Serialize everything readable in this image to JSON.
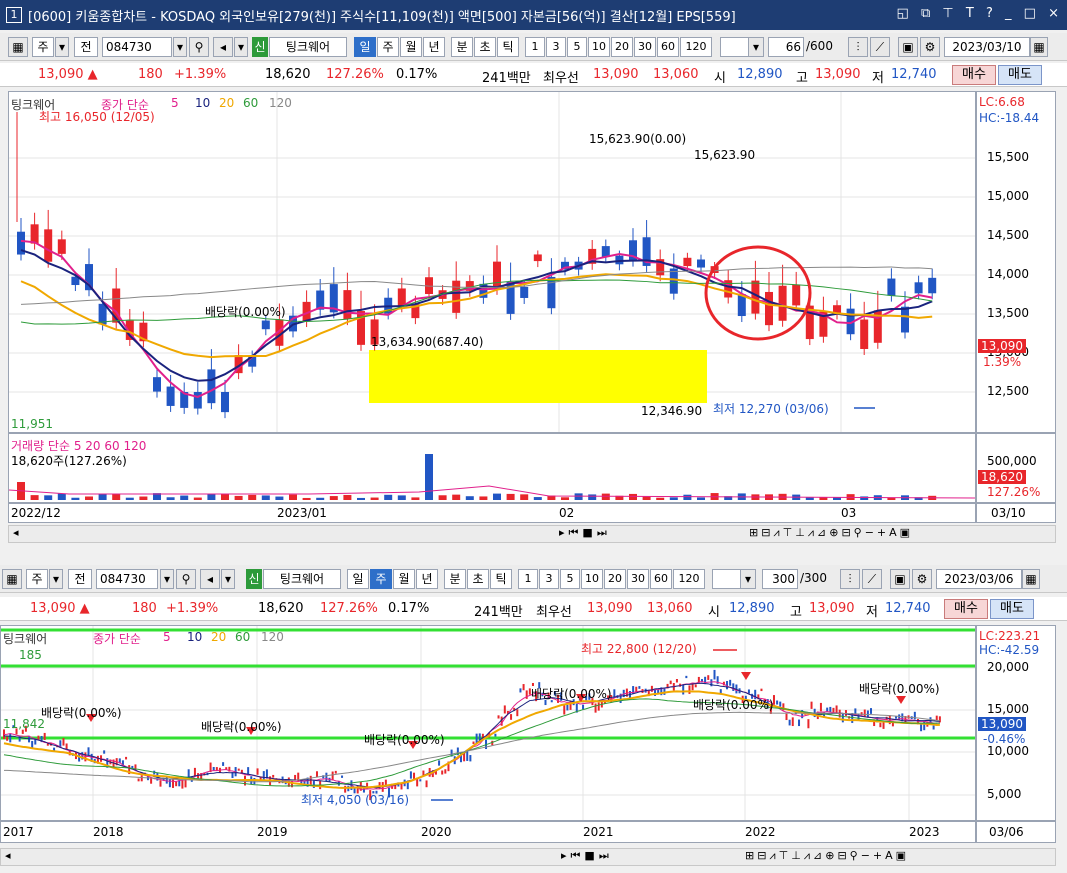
{
  "window": {
    "number": "1",
    "title": "[0600] 키움종합차트 - KOSDAQ 외국인보유[279(천)] 주식수[11,109(천)] 액면[500] 자본금[56(억)] 결산[12월] EPS[559]",
    "buttons": [
      "◱",
      "⧉",
      "⊤",
      "T",
      "?",
      "_",
      "□",
      "×"
    ]
  },
  "panels": [
    {
      "toolbar": {
        "type_label": "주",
        "prev_label": "전",
        "code": "084730",
        "new_badge": "신",
        "stock_name": "팅크웨어",
        "periods": [
          "일",
          "주",
          "월",
          "년"
        ],
        "active_period": "일",
        "subperiods": [
          "분",
          "초",
          "틱"
        ],
        "intervals": [
          "1",
          "3",
          "5",
          "10",
          "20",
          "30",
          "60",
          "120"
        ],
        "count": "66",
        "count_total": "/600",
        "date": "2023/03/10"
      },
      "info": {
        "price": "13,090 ▲",
        "change": "180",
        "change_pct": "+1.39%",
        "volume": "18,620",
        "volume_pct": "127.26%",
        "turnover": "0.17%",
        "amount": "241백만",
        "best_label": "최우선",
        "ask": "13,090",
        "bid": "13,060",
        "open_label": "시",
        "open": "12,890",
        "high_label": "고",
        "high": "13,090",
        "low_label": "저",
        "low": "12,740",
        "buy": "매수",
        "sell": "매도"
      },
      "legend": {
        "name": "팅크웨어",
        "ma_label": "종가 단순",
        "ma": [
          "5",
          "10",
          "20",
          "60",
          "120"
        ]
      },
      "annotations": {
        "max": "최고 16,050 (12/05)",
        "min": "최저 12,270 (03/06)",
        "dividend": "배당락(0.00%)",
        "box_top": "13,634.90(687.40)",
        "box_bottom": "12,346.90",
        "top_line": "15,623.90(0.00)",
        "top_line2": "15,623.90",
        "left_value": "11,951",
        "lc": "LC:6.68",
        "hc": "HC:-18.44",
        "price_tag": "13,090",
        "price_pct": "1.39%"
      },
      "y_ticks": [
        "15,500",
        "15,000",
        "14,500",
        "14,000",
        "13,500",
        "13,000",
        "12,500"
      ],
      "volume": {
        "legend": "거래량 단순 5 20 60 120",
        "label": "18,620주(127.26%)",
        "y_tick": "500,000",
        "tag": "18,620",
        "tag_pct": "127.26%"
      },
      "x_labels": [
        "2022/12",
        "2023/01",
        "02",
        "03"
      ],
      "x_end": "03/10"
    },
    {
      "toolbar": {
        "type_label": "주",
        "prev_label": "전",
        "code": "084730",
        "new_badge": "신",
        "stock_name": "팅크웨어",
        "periods": [
          "일",
          "주",
          "월",
          "년"
        ],
        "active_period": "주",
        "subperiods": [
          "분",
          "초",
          "틱"
        ],
        "intervals": [
          "1",
          "3",
          "5",
          "10",
          "20",
          "30",
          "60",
          "120"
        ],
        "count": "300",
        "count_total": "/300",
        "date": "2023/03/06"
      },
      "info": {
        "price": "13,090 ▲",
        "change": "180",
        "change_pct": "+1.39%",
        "volume": "18,620",
        "volume_pct": "127.26%",
        "turnover": "0.17%",
        "amount": "241백만",
        "best_label": "최우선",
        "ask": "13,090",
        "bid": "13,060",
        "open_label": "시",
        "open": "12,890",
        "high_label": "고",
        "high": "13,090",
        "low_label": "저",
        "low": "12,740",
        "buy": "매수",
        "sell": "매도"
      },
      "legend": {
        "name": "팅크웨어",
        "ma_label": "종가 단순",
        "ma": [
          "5",
          "10",
          "20",
          "60",
          "120"
        ]
      },
      "annotations": {
        "max": "최고 22,800 (12/20)",
        "min": "최저 4,050 (03/16)",
        "dividend": "배당락(0.00%)",
        "left_value": "11,842",
        "left_top": "185",
        "lc": "LC:223.21",
        "hc": "HC:-42.59",
        "price_tag": "13,090",
        "price_pct": "-0.46%"
      },
      "y_ticks": [
        "20,000",
        "15,000",
        "10,000",
        "5,000"
      ],
      "x_labels": [
        "2017",
        "2018",
        "2019",
        "2020",
        "2021",
        "2022",
        "2023"
      ],
      "x_end": "03/06"
    }
  ],
  "colors": {
    "up": "#e8262b",
    "down": "#2156c4",
    "ma5": "#e1208c",
    "ma10": "#1a237e",
    "ma20": "#f0a800",
    "ma60": "#2e9b3a",
    "ma120": "#888888",
    "highlight": "#ffff00",
    "circle": "#e8262b",
    "hline": "#33e033"
  }
}
